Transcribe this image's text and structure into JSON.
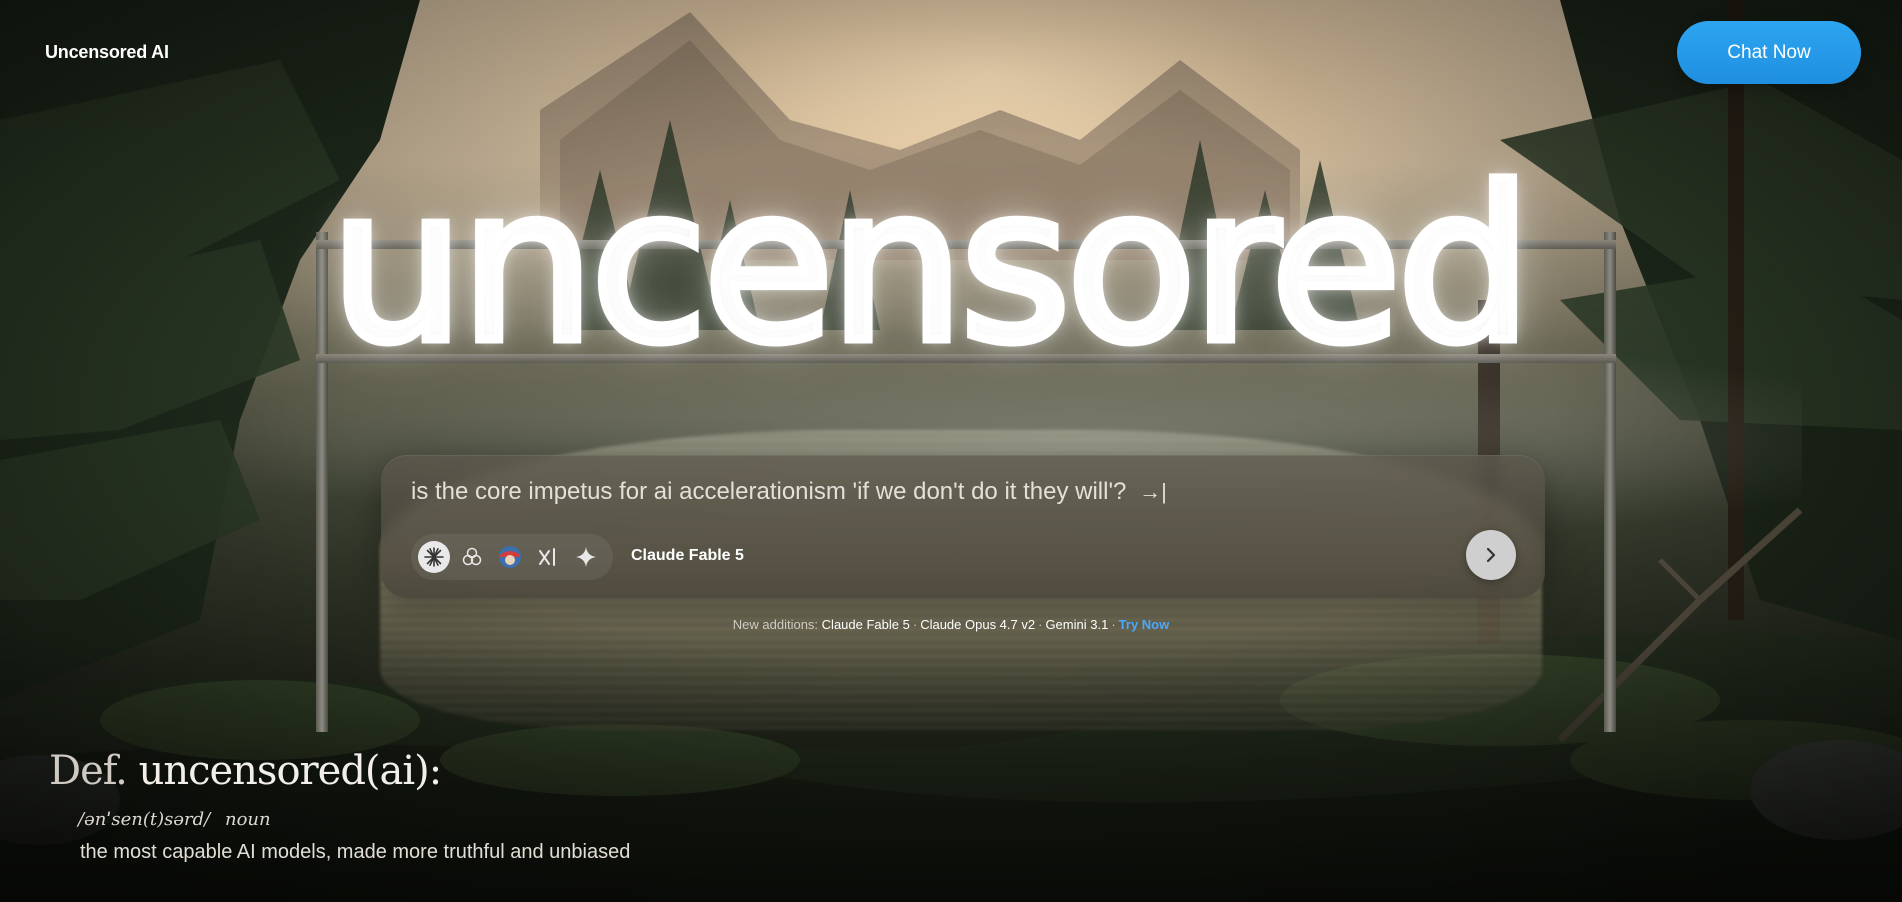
{
  "header": {
    "brand": "Uncensored AI",
    "cta_label": "Chat Now"
  },
  "hero": {
    "neon_word": "uncensored"
  },
  "prompt": {
    "text": "is the core impetus for ai accelerationism 'if we don't do it they will'?",
    "tab_hint": "→|",
    "selected_model": "Claude Fable 5",
    "models": [
      "claude-icon",
      "openai-icon",
      "model-avatar-icon",
      "xai-icon",
      "gemini-icon"
    ]
  },
  "additions": {
    "label": "New additions:",
    "items": [
      "Claude Fable 5",
      "Claude Opus 4.7 v2",
      "Gemini 3.1"
    ],
    "separator": "·",
    "link": "Try Now"
  },
  "definition": {
    "prefix": "Def.",
    "term": "uncensored(ai):",
    "pronunciation": "/ənˈsen(t)sərd/",
    "part_of_speech": "noun",
    "body": "the most capable AI models, made more truthful and unbiased"
  },
  "colors": {
    "accent": "#2da5f0",
    "link": "#4aa8ff"
  }
}
